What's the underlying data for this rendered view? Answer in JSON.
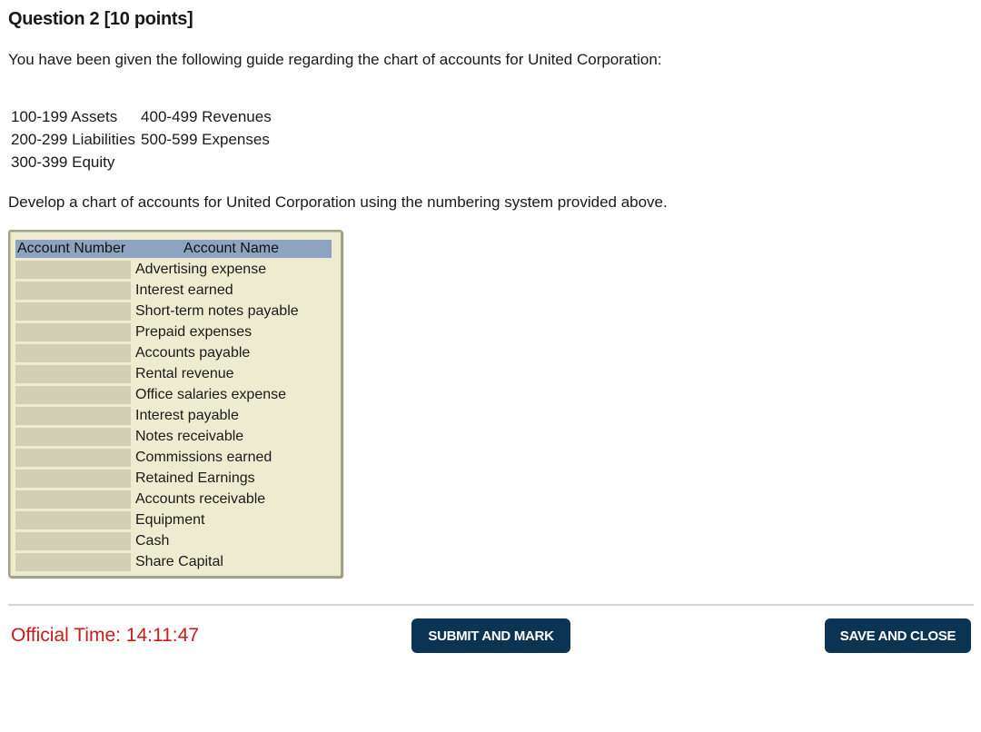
{
  "question": {
    "title": "Question 2 [10 points]",
    "intro": "You have been given the following guide regarding the chart of accounts for United Corporation:",
    "guide": [
      [
        "100-199 Assets",
        "400-499 Revenues"
      ],
      [
        "200-299 Liabilities",
        "500-599 Expenses"
      ],
      [
        "300-399 Equity",
        ""
      ]
    ],
    "instruction": "Develop a chart of accounts for United Corporation using the numbering system provided above."
  },
  "accounts_table": {
    "headers": {
      "number": "Account Number",
      "name": "Account Name"
    },
    "rows": [
      {
        "number": "",
        "name": "Advertising expense"
      },
      {
        "number": "",
        "name": "Interest earned"
      },
      {
        "number": "",
        "name": "Short-term notes payable"
      },
      {
        "number": "",
        "name": "Prepaid expenses"
      },
      {
        "number": "",
        "name": "Accounts payable"
      },
      {
        "number": "",
        "name": "Rental revenue"
      },
      {
        "number": "",
        "name": "Office salaries expense"
      },
      {
        "number": "",
        "name": "Interest payable"
      },
      {
        "number": "",
        "name": "Notes receivable"
      },
      {
        "number": "",
        "name": "Commissions earned"
      },
      {
        "number": "",
        "name": "Retained Earnings"
      },
      {
        "number": "",
        "name": "Accounts receivable"
      },
      {
        "number": "",
        "name": "Equipment"
      },
      {
        "number": "",
        "name": "Cash"
      },
      {
        "number": "",
        "name": "Share Capital"
      }
    ]
  },
  "footer": {
    "official_time": "Official Time: 14:11:47",
    "submit_label": "SUBMIT AND MARK",
    "save_label": "SAVE AND CLOSE"
  },
  "colors": {
    "time_text": "#cc1a1a",
    "button_bg": "#0b3352",
    "table_header_bg": "#8ea2c2",
    "table_bg": "#eeecd0",
    "input_cell_bg": "#d1d0b4"
  }
}
